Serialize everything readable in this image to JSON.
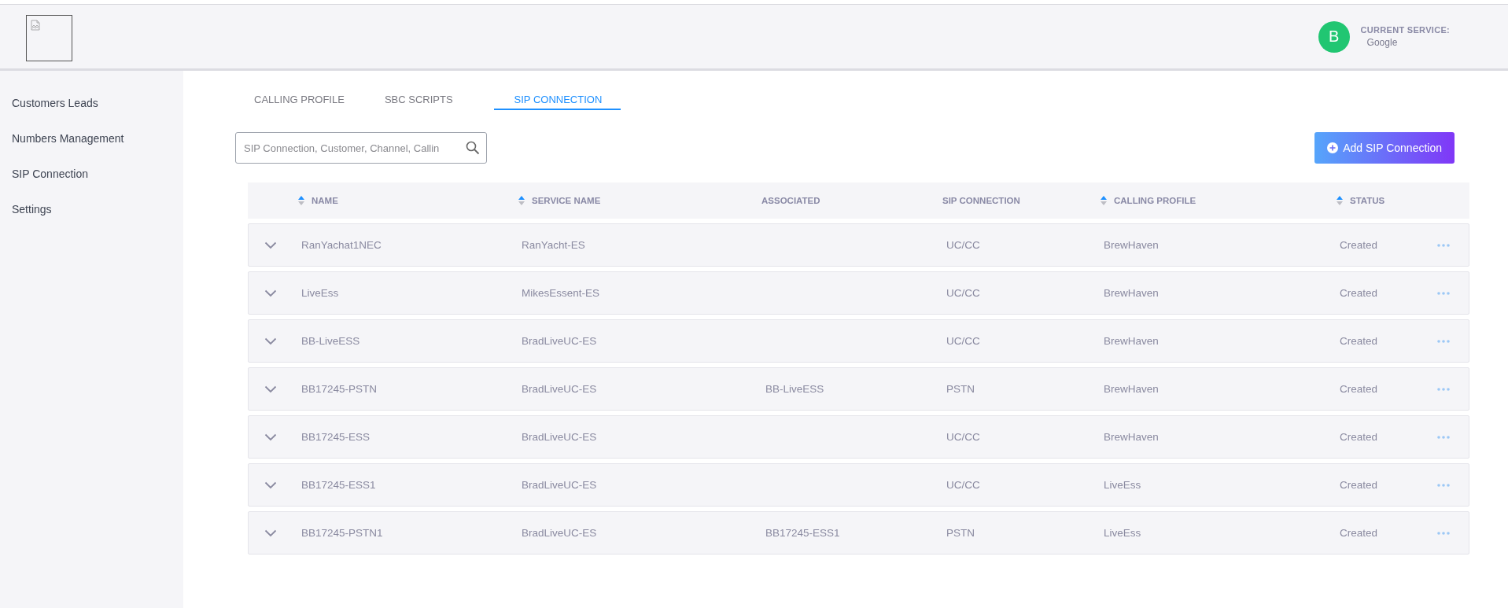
{
  "header": {
    "avatar_letter": "B",
    "service_label": "CURRENT SERVICE:",
    "service_name": "Google"
  },
  "sidebar": {
    "items": [
      {
        "label": "Customers Leads",
        "selected": false
      },
      {
        "label": "Numbers Management",
        "selected": false
      },
      {
        "label": "SIP Connection",
        "selected": false
      },
      {
        "label": "Settings",
        "selected": false
      }
    ]
  },
  "tabs": [
    {
      "label": "CALLING PROFILE",
      "selected": false
    },
    {
      "label": "SBC SCRIPTS",
      "selected": false
    },
    {
      "label": "SIP CONNECTION",
      "selected": true
    }
  ],
  "search": {
    "placeholder": "SIP Connection, Customer, Channel, Callin"
  },
  "add_button": "Add SIP Connection",
  "table": {
    "columns": [
      {
        "label": "NAME",
        "sortable": true
      },
      {
        "label": "SERVICE NAME",
        "sortable": true
      },
      {
        "label": "ASSOCIATED",
        "sortable": false
      },
      {
        "label": "SIP CONNECTION",
        "sortable": false
      },
      {
        "label": "CALLING PROFILE",
        "sortable": true
      },
      {
        "label": "STATUS",
        "sortable": true
      }
    ],
    "rows": [
      {
        "cells": [
          "RanYachat1NEC",
          "RanYacht-ES",
          "",
          "UC/CC",
          "BrewHaven",
          "Created"
        ]
      },
      {
        "cells": [
          "LiveEss",
          "MikesEssent-ES",
          "",
          "UC/CC",
          "BrewHaven",
          "Created"
        ]
      },
      {
        "cells": [
          "BB-LiveESS",
          "BradLiveUC-ES",
          "",
          "UC/CC",
          "BrewHaven",
          "Created"
        ]
      },
      {
        "cells": [
          "BB17245-PSTN",
          "BradLiveUC-ES",
          "BB-LiveESS",
          "PSTN",
          "BrewHaven",
          "Created"
        ]
      },
      {
        "cells": [
          "BB17245-ESS",
          "BradLiveUC-ES",
          "",
          "UC/CC",
          "BrewHaven",
          "Created"
        ]
      },
      {
        "cells": [
          "BB17245-ESS1",
          "BradLiveUC-ES",
          "",
          "UC/CC",
          "LiveEss",
          "Created"
        ]
      },
      {
        "cells": [
          "BB17245-PSTN1",
          "BradLiveUC-ES",
          "BB17245-ESS1",
          "PSTN",
          "LiveEss",
          "Created"
        ]
      }
    ]
  }
}
